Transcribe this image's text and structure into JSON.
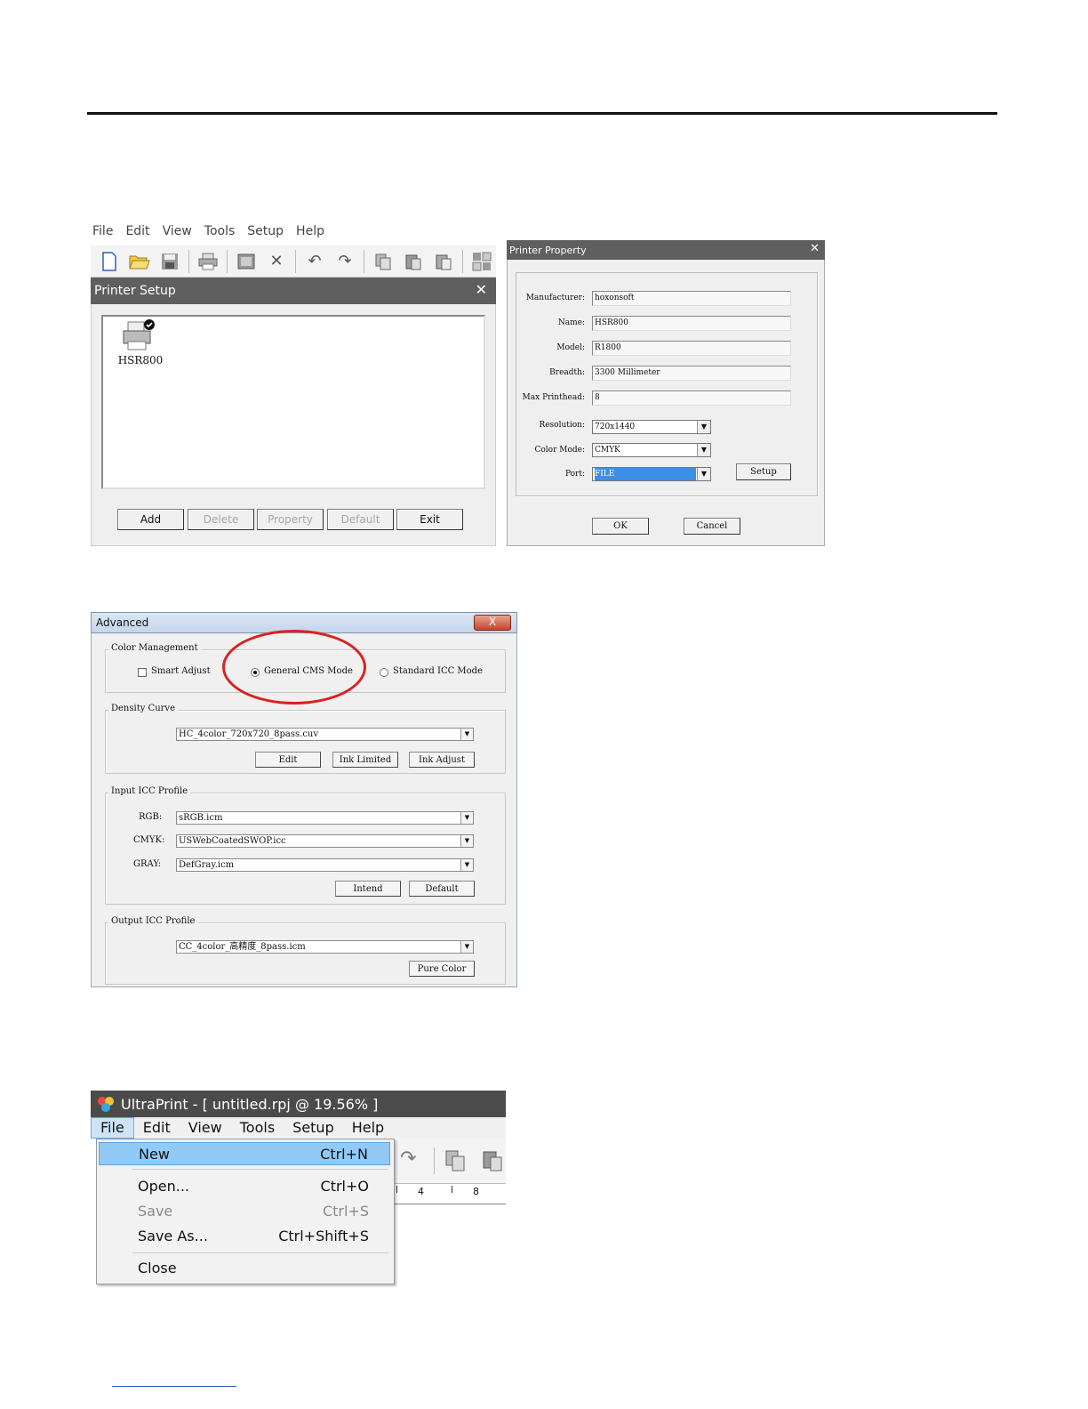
{
  "menubar": [
    "File",
    "Edit",
    "View",
    "Tools",
    "Setup",
    "Help"
  ],
  "printer_setup": {
    "title": "Printer Setup",
    "printer_name": "HSR800",
    "buttons": {
      "add": "Add",
      "delete": "Delete",
      "property": "Property",
      "default": "Default",
      "exit": "Exit"
    }
  },
  "printer_property": {
    "title": "Printer Property",
    "fields": {
      "manufacturer": {
        "label": "Manufacturer:",
        "value": "hoxonsoft"
      },
      "name": {
        "label": "Name:",
        "value": "HSR800"
      },
      "model": {
        "label": "Model:",
        "value": "R1800"
      },
      "breadth": {
        "label": "Breadth:",
        "value": "3300 Millimeter"
      },
      "max_printhead": {
        "label": "Max Printhead:",
        "value": "8"
      }
    },
    "resolution": {
      "label": "Resolution:",
      "value": "720x1440"
    },
    "color_mode": {
      "label": "Color Mode:",
      "value": "CMYK"
    },
    "port": {
      "label": "Port:",
      "value": "FILE"
    },
    "setup_button": "Setup",
    "ok_button": "OK",
    "cancel_button": "Cancel"
  },
  "advanced": {
    "title": "Advanced",
    "close": "X",
    "color_management": {
      "caption": "Color Management",
      "smart_adjust": "Smart Adjust",
      "general_cms": "General CMS Mode",
      "standard_icc": "Standard ICC Mode"
    },
    "density_curve": {
      "caption": "Density Curve",
      "file": "HC_4color_720x720_8pass.cuv",
      "edit": "Edit",
      "ink_limited": "Ink Limited",
      "ink_adjust": "Ink Adjust"
    },
    "input_icc": {
      "caption": "Input ICC Profile",
      "rgb_label": "RGB:",
      "rgb": "sRGB.icm",
      "cmyk_label": "CMYK:",
      "cmyk": "USWebCoatedSWOP.icc",
      "gray_label": "GRAY:",
      "gray": "DefGray.icm",
      "intend": "Intend",
      "default": "Default"
    },
    "output_icc": {
      "caption": "Output ICC Profile",
      "file": "CC_4color_高精度_8pass.icm",
      "pure_color": "Pure Color"
    }
  },
  "ultraprint": {
    "title": "UltraPrint - [ untitled.rpj @ 19.56% ]",
    "ruler": [
      "4",
      "8"
    ],
    "file_menu": [
      {
        "label": "New",
        "shortcut": "Ctrl+N"
      },
      {
        "label": "Open...",
        "shortcut": "Ctrl+O"
      },
      {
        "label": "Save",
        "shortcut": "Ctrl+S"
      },
      {
        "label": "Save As...",
        "shortcut": "Ctrl+Shift+S"
      },
      {
        "label": "Close",
        "shortcut": ""
      }
    ]
  },
  "colors": {
    "accent_red": "#d8231f",
    "highlight_blue": "#91c9f7",
    "title_gray": "#5f5f5f"
  }
}
